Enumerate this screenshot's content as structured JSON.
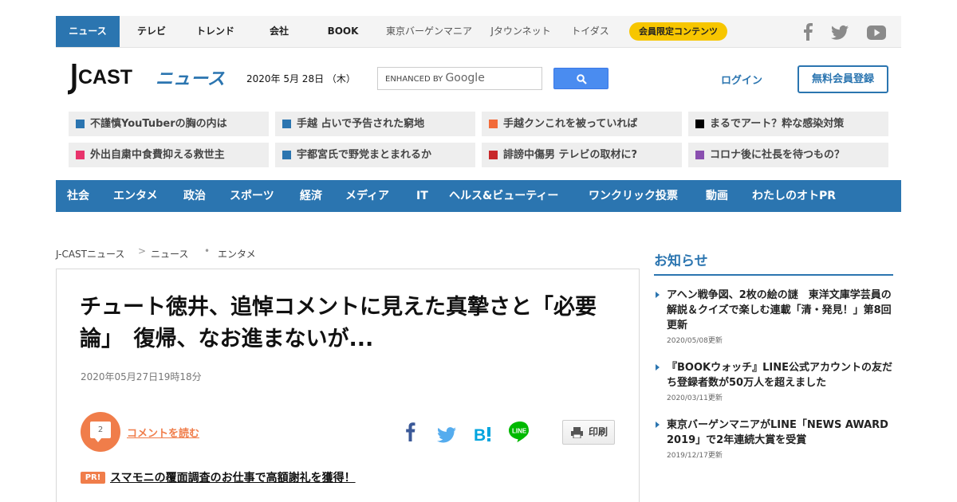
{
  "topnav": {
    "items": [
      "ニュース",
      "テレビ",
      "トレンド",
      "会社",
      "BOOK",
      "東京バーゲンマニア",
      "Jタウンネット",
      "トイダス"
    ],
    "member_badge": "会員限定コンテンツ",
    "social_icons": [
      "facebook-icon",
      "twitter-icon",
      "youtube-icon"
    ]
  },
  "header": {
    "logo_text_main": "J-CAST",
    "logo_text_sub": "ニュース",
    "date": "2020年 5月 28日 （木）",
    "search_prefix": "ENHANCED BY",
    "search_brand": "Google",
    "login": "ログイン",
    "register": "無料会員登録"
  },
  "headlines": [
    {
      "text": "不謹慎YouTuberの胸の内は",
      "color": "#2b75b0"
    },
    {
      "text": "手越 占いで予告された窮地",
      "color": "#2b75b0"
    },
    {
      "text": "手越クンこれを被っていれば",
      "color": "#f26b3a"
    },
    {
      "text": "まるでアート？粋な感染対策",
      "color": "#000000"
    },
    {
      "text": "外出自粛中食費抑える救世主",
      "color": "#e8336b"
    },
    {
      "text": "宇都宮氏で野党まとまれるか",
      "color": "#2b75b0"
    },
    {
      "text": "誹謗中傷男 テレビの取材に?",
      "color": "#c8282a"
    },
    {
      "text": "コロナ後に社長を待つもの？",
      "color": "#8a4fb0"
    }
  ],
  "categories": [
    "社会",
    "エンタメ",
    "政治",
    "スポーツ",
    "経済",
    "メディア",
    "IT",
    "ヘルス&ビューティー",
    "ワンクリック投票",
    "動画",
    "わたしのオトPR"
  ],
  "breadcrumb": [
    "J-CASTニュース",
    "ニュース",
    "エンタメ"
  ],
  "article": {
    "title": "チュート徳井、追悼コメントに見えた真摯さと「必要論」　復帰、なお進まないが...",
    "date": "2020年05月27日19時18分",
    "comment_count": "2",
    "comment_link": "コメントを読む",
    "print": "印刷",
    "pr_badge": "PR!",
    "pr_text": "スマモニの覆面調査のお仕事で高額謝礼を獲得！"
  },
  "sidebar": {
    "title": "お知らせ",
    "news": [
      {
        "text": "アヘン戦争図、2枚の絵の謎　東洋文庫学芸員の解説＆クイズで楽しむ連載「清・発見！」第8回更新",
        "date": "2020/05/08更新"
      },
      {
        "text": "『BOOKウォッチ』LINE公式アカウントの友だち登録者数が50万人を超えました",
        "date": "2020/03/11更新"
      },
      {
        "text": "東京バーゲンマニアがLINE「NEWS AWARD 2019」で2年連続大賞を受賞",
        "date": "2019/12/17更新"
      }
    ]
  },
  "colors": {
    "brand": "#2b75b0",
    "accent": "#f07d4a",
    "badge": "#f7c600"
  }
}
